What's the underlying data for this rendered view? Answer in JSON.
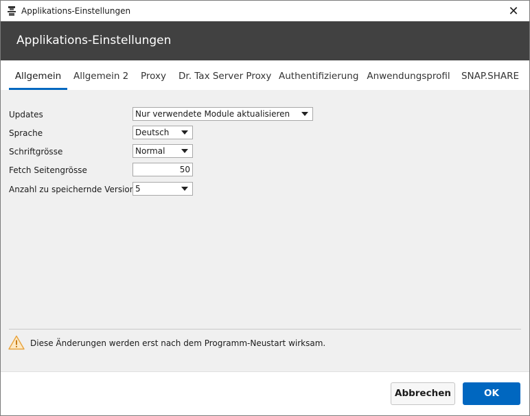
{
  "window": {
    "title": "Applikations-Einstellungen",
    "app_icon": "app-logo-icon",
    "close_glyph": "✕"
  },
  "header": {
    "title": "Applikations-Einstellungen"
  },
  "tabs": [
    {
      "label": "Allgemein",
      "active": true
    },
    {
      "label": "Allgemein 2",
      "active": false
    },
    {
      "label": "Proxy",
      "active": false
    },
    {
      "label": "Dr. Tax Server Proxy",
      "active": false
    },
    {
      "label": "Authentifizierung",
      "active": false
    },
    {
      "label": "Anwendungsprofil",
      "active": false
    },
    {
      "label": "SNAP.SHARE",
      "active": false
    }
  ],
  "form": {
    "updates": {
      "label": "Updates",
      "value": "Nur verwendete Module aktualisieren"
    },
    "sprache": {
      "label": "Sprache",
      "value": "Deutsch"
    },
    "schriftgroesse": {
      "label": "Schriftgrösse",
      "value": "Normal"
    },
    "fetch": {
      "label": "Fetch Seitengrösse",
      "value": "50"
    },
    "versionen": {
      "label": "Anzahl zu speichernde Versionen",
      "value": "5"
    }
  },
  "notice": {
    "icon": "warning-icon",
    "text": "Diese Änderungen werden erst nach dem Programm-Neustart wirksam."
  },
  "footer": {
    "cancel_label": "Abbrechen",
    "ok_label": "OK"
  },
  "colors": {
    "header_bg": "#414141",
    "accent": "#0067c0",
    "warning": "#f5a623"
  }
}
